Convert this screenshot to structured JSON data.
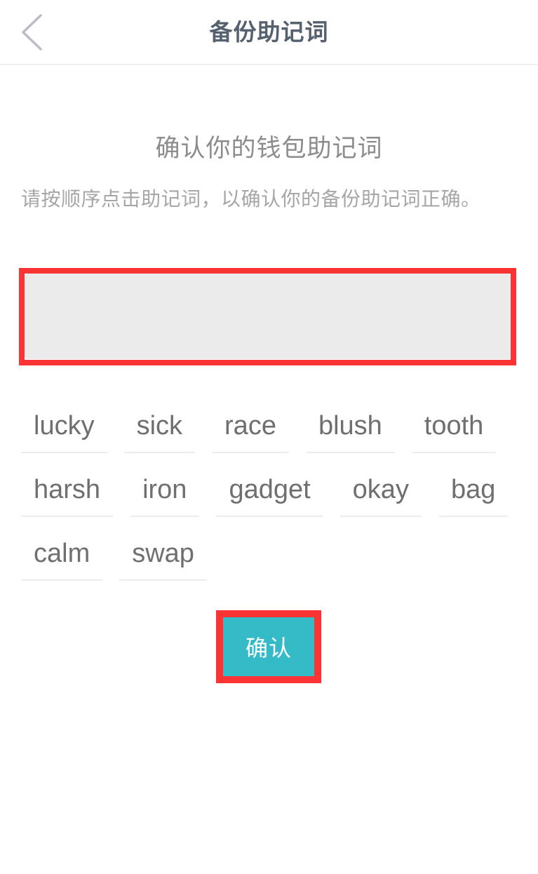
{
  "header": {
    "title": "备份助记词",
    "back_icon": "chevron-left-icon"
  },
  "main": {
    "page_title": "确认你的钱包助记词",
    "description": "请按顺序点击助记词，以确认你的备份助记词正确。",
    "selected_words": [],
    "selected_panel_placeholder": ""
  },
  "word_bank": {
    "rows": [
      [
        "lucky",
        "sick",
        "race",
        "blush",
        "tooth"
      ],
      [
        "harsh",
        "iron",
        "gadget",
        "okay",
        "bag"
      ],
      [
        "calm",
        "swap"
      ]
    ],
    "words": [
      "lucky",
      "sick",
      "race",
      "blush",
      "tooth",
      "harsh",
      "iron",
      "gadget",
      "okay",
      "bag",
      "calm",
      "swap"
    ]
  },
  "actions": {
    "confirm_label": "确认"
  },
  "colors": {
    "accent_teal": "#35bac7",
    "annotation_red": "#fa3434",
    "header_title": "#55616e",
    "panel_gray": "#ebebeb",
    "word_text": "#6f6f6f",
    "description_text": "#a6a6a6",
    "page_background": "#ffffff"
  }
}
